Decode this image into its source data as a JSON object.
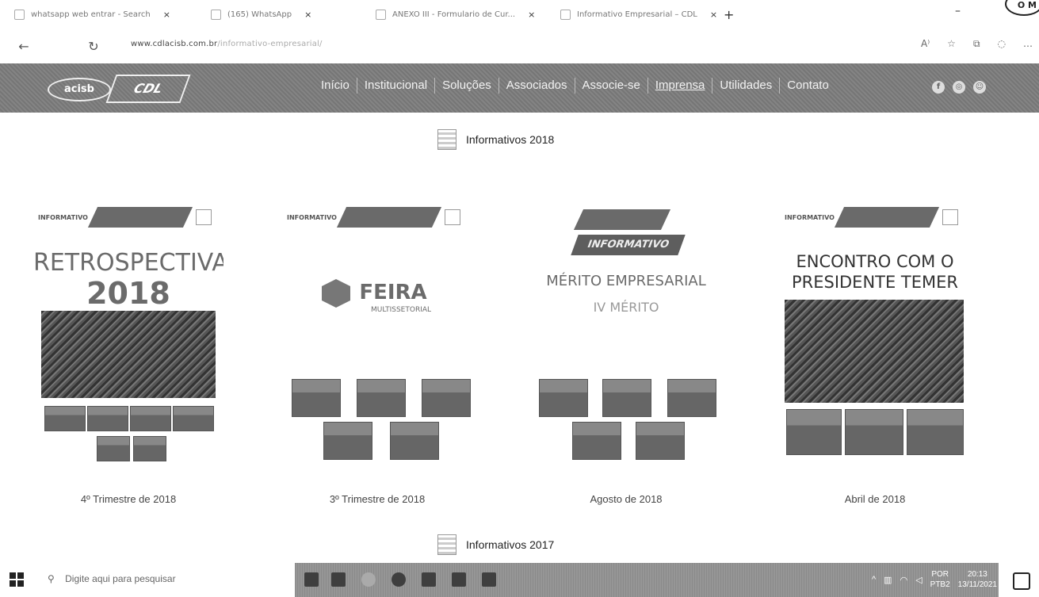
{
  "browser": {
    "tabs": [
      {
        "label": "whatsapp web entrar - Search"
      },
      {
        "label": "(165) WhatsApp"
      },
      {
        "label": "ANEXO III - Formulario de Cur..."
      },
      {
        "label": "Informativo Empresarial – CDL"
      }
    ],
    "new_tab": "+",
    "close": "×",
    "url_host": "www.cdlacisb.com.br",
    "url_rest": "/informativo-empresarial/"
  },
  "stamp": "O M",
  "site": {
    "logo1": "acisb",
    "logo2": "CDL",
    "menu": [
      "Início",
      "Institucional",
      "Soluções",
      "Associados",
      "Associe-se",
      "Imprensa",
      "Utilidades",
      "Contato"
    ],
    "active_menu": "Imprensa",
    "social": [
      "f",
      "◎",
      "☺"
    ]
  },
  "sections": [
    {
      "title": "Informativos 2018"
    },
    {
      "title": "Informativos 2017"
    }
  ],
  "cards": [
    {
      "caption": "4º Trimestre de 2018",
      "heading1": "RETROSPECTIVA",
      "heading2": "2018",
      "band_label": "INFORMATIVO"
    },
    {
      "caption": "3º Trimestre de 2018",
      "heading1": "FEIRA",
      "heading2": "MULTISSETORIAL",
      "band_label": "INFORMATIVO"
    },
    {
      "caption": "Agosto de 2018",
      "heading1": "MÉRITO EMPRESARIAL",
      "heading2": "IV MÉRITO",
      "band_label": "INFORMATIVO"
    },
    {
      "caption": "Abril de 2018",
      "heading1": "ENCONTRO COM O",
      "heading2": "PRESIDENTE TEMER",
      "band_label": "INFORMATIVO"
    }
  ],
  "taskbar": {
    "search_placeholder": "Digite aqui para pesquisar",
    "lang1": "POR",
    "lang2": "PTB2",
    "time": "20:13",
    "date": "13/11/2021"
  }
}
